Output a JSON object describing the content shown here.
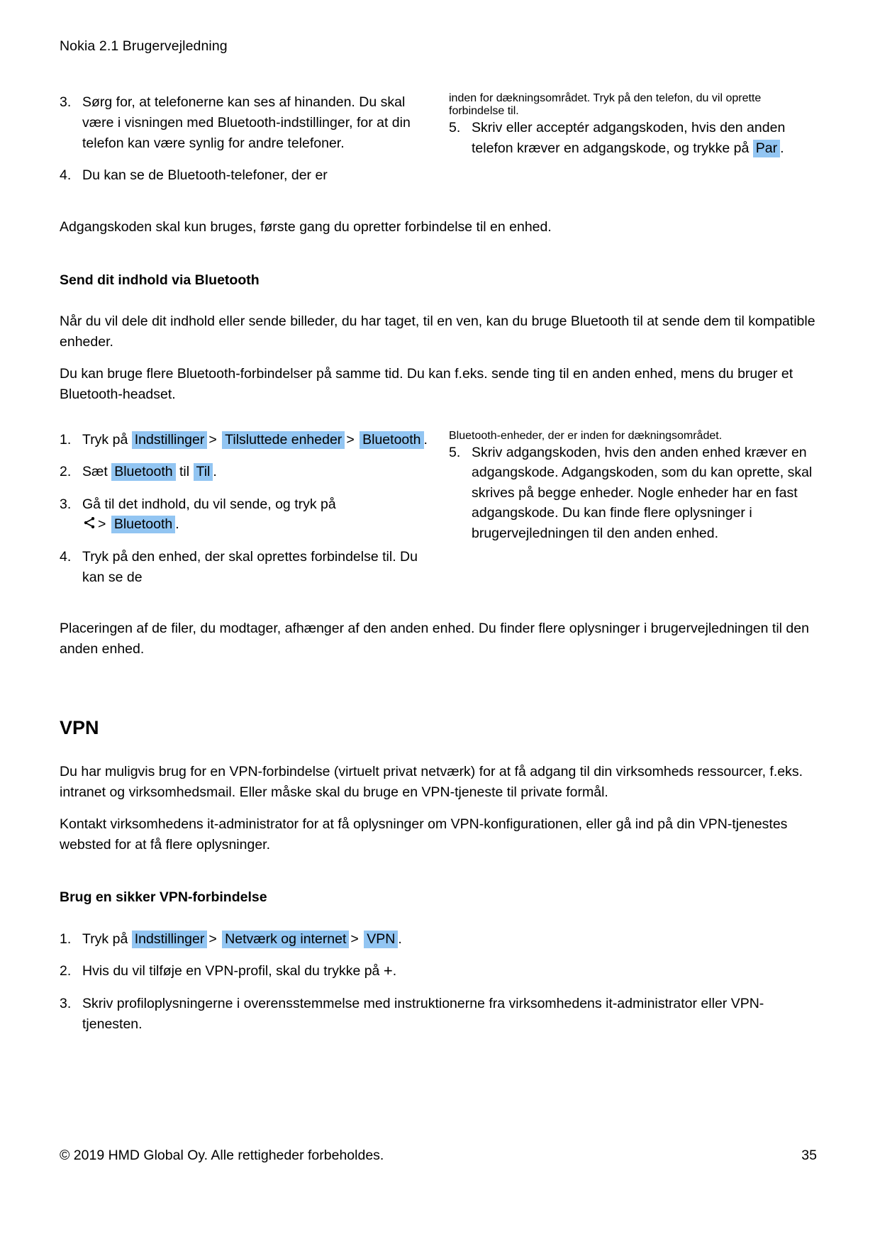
{
  "header": {
    "running_head": "Nokia 2.1 Brugervejledning"
  },
  "bluetooth_pair_steps": {
    "left": [
      {
        "num": "3.",
        "text": "Sørg for, at telefonerne kan ses af hinanden. Du skal være i visningen med Bluetooth-indstillinger, for at din telefon kan være synlig for andre telefoner."
      },
      {
        "num": "4.",
        "text": "Du kan se de Bluetooth-telefoner, der er"
      }
    ],
    "right_continuation": "inden for dækningsområdet. Tryk på den telefon, du vil oprette forbindelse til.",
    "right": [
      {
        "num": "5.",
        "pre": "Skriv eller acceptér adgangskoden, hvis den anden telefon kræver en adgangskode, og trykke på",
        "highlight": "Par",
        "post": "."
      }
    ]
  },
  "passcode_note": "Adgangskoden skal kun bruges, første gang du opretter forbindelse til en enhed.",
  "send_content": {
    "heading": "Send dit indhold via Bluetooth",
    "paragraphs": [
      "Når du vil dele dit indhold eller sende billeder, du har taget, til en ven, kan du bruge Bluetooth til at sende dem til kompatible enheder.",
      "Du kan bruge flere Bluetooth-forbindelser på samme tid. Du kan f.eks. sende ting til en anden enhed, mens du bruger et Bluetooth-headset."
    ],
    "steps_left": [
      {
        "num": "1.",
        "pre": "Tryk på",
        "chips": [
          "Indstillinger",
          "Tilsluttede enheder",
          "Bluetooth"
        ],
        "separator": ">",
        "post": "."
      },
      {
        "num": "2.",
        "pre": "Sæt",
        "chip1": "Bluetooth",
        "mid": "til",
        "chip2": "Til",
        "post": "."
      },
      {
        "num": "3.",
        "pre": "Gå til det indhold, du vil sende, og tryk på",
        "icon": "share-icon",
        "separator": ">",
        "chip": "Bluetooth",
        "post": "."
      },
      {
        "num": "4.",
        "text": "Tryk på den enhed, der skal oprettes forbindelse til. Du kan se de"
      }
    ],
    "steps_right_continuation": "Bluetooth-enheder, der er inden for dækningsområdet.",
    "steps_right": [
      {
        "num": "5.",
        "text": "Skriv adgangskoden, hvis den anden enhed kræver en adgangskode. Adgangskoden, som du kan oprette, skal skrives på begge enheder. Nogle enheder har en fast adgangskode. Du kan finde flere oplysninger i brugervejledningen til den anden enhed."
      }
    ],
    "closing": "Placeringen af de filer, du modtager, afhænger af den anden enhed. Du finder flere oplysninger i brugervejledningen til den anden enhed."
  },
  "vpn": {
    "heading": "VPN",
    "paragraphs": [
      "Du har muligvis brug for en VPN-forbindelse (virtuelt privat netværk) for at få adgang til din virksomheds ressourcer, f.eks. intranet og virksomhedsmail. Eller måske skal du bruge en VPN-tjeneste til private formål.",
      "Kontakt virksomhedens it-administrator for at få oplysninger om VPN-konfigurationen, eller gå ind på din VPN-tjenestes websted for at få flere oplysninger."
    ],
    "sub_heading": "Brug en sikker VPN-forbindelse",
    "steps": [
      {
        "num": "1.",
        "pre": "Tryk på",
        "chips": [
          "Indstillinger",
          "Netværk og internet",
          "VPN"
        ],
        "separator": ">",
        "post": "."
      },
      {
        "num": "2.",
        "pre": "Hvis du vil tilføje en VPN-profil, skal du trykke på",
        "icon": "plus-icon",
        "post": "."
      },
      {
        "num": "3.",
        "text": "Skriv profiloplysningerne i overensstemmelse med instruktionerne fra virksomhedens it-administrator eller VPN-tjenesten."
      }
    ]
  },
  "footer": {
    "copyright": "© 2019 HMD Global Oy. Alle rettigheder forbeholdes.",
    "page_number": "35"
  },
  "colors": {
    "highlight": "#92c5f2",
    "text": "#000000",
    "background": "#ffffff"
  }
}
